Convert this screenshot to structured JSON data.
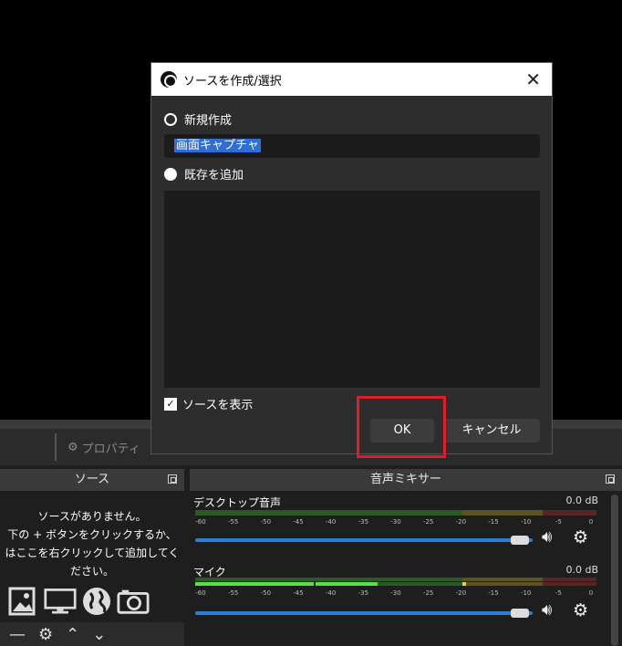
{
  "dialog": {
    "title": "ソースを作成/選択",
    "create_new_label": "新規作成",
    "name_value": "画面キャプチャ",
    "add_existing_label": "既存を追加",
    "visible_label": "ソースを表示",
    "ok_label": "OK",
    "cancel_label": "キャンセル"
  },
  "controlbar": {
    "properties_label": "プロパティ"
  },
  "sources": {
    "title": "ソース",
    "empty_line1": "ソースがありません。",
    "empty_line2": "下の + ボタンをクリックするか、",
    "empty_line3": "はここを右クリックして追加してください。"
  },
  "mixer": {
    "title": "音声ミキサー",
    "tracks": [
      {
        "name": "デスクトップ音声",
        "db": "0.0 dB",
        "volume": 1.0
      },
      {
        "name": "マイク",
        "db": "0.0 dB",
        "volume": 1.0
      }
    ],
    "ticks": [
      "-60",
      "-55",
      "-50",
      "-45",
      "-40",
      "-35",
      "-30",
      "-25",
      "-20",
      "-15",
      "-10",
      "-5",
      "0"
    ]
  },
  "colors": {
    "accent": "#2f6ed6",
    "highlight": "#e01e2a",
    "meter_green": "#4fbf3a",
    "meter_yellow": "#c9b23a",
    "meter_red": "#b23a3a"
  }
}
